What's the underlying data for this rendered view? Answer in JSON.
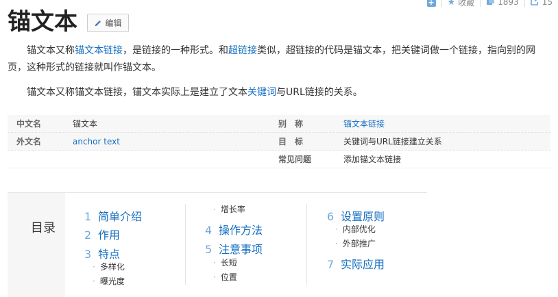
{
  "toolbar": {
    "collect_label": "收藏",
    "like_count": "1893",
    "share_count": "15"
  },
  "title": "锚文本",
  "edit_label": "编辑",
  "para1": {
    "t1": "锚文本又称",
    "l1": "锚文本链接",
    "t2": "，是链接的一种形式。和",
    "l2": "超链接",
    "t3": "类似，超链接的代码是锚文本，把关键词做一个链接，指向别的网页，这种形式的链接就叫作锚文本。"
  },
  "para2": {
    "t1": "锚文本又称锚文本链接，锚文本实际上是建立了文本",
    "l1": "关键词",
    "t2": "与URL链接的关系。"
  },
  "basic_info": [
    {
      "name": "中文名",
      "value": "锚文本",
      "name2": "别　称",
      "value2": "锚文本链接"
    },
    {
      "name": "外文名",
      "value": "anchor text",
      "name2": "目　标",
      "value2": "关键词与URL链接建立关系"
    },
    {
      "name": "",
      "value": "",
      "name2": "常见问题",
      "value2": "添加锚文本链接"
    }
  ],
  "catalog": {
    "title": "目录",
    "items": [
      {
        "num": "1",
        "label": "简单介绍"
      },
      {
        "num": "2",
        "label": "作用"
      },
      {
        "num": "3",
        "label": "特点"
      },
      {
        "sub": "多样化"
      },
      {
        "sub": "曝光度"
      },
      {
        "sub": "增长率"
      },
      {
        "num": "4",
        "label": "操作方法"
      },
      {
        "num": "5",
        "label": "注意事项"
      },
      {
        "sub": "长短"
      },
      {
        "sub": "位置"
      },
      {
        "num": "6",
        "label": "设置原则"
      },
      {
        "sub": "内部优化"
      },
      {
        "sub": "外部推广"
      },
      {
        "num": "7",
        "label": "实际应用"
      }
    ]
  },
  "colors": {
    "link": "#136ec2",
    "accent": "#6fa8dc"
  }
}
